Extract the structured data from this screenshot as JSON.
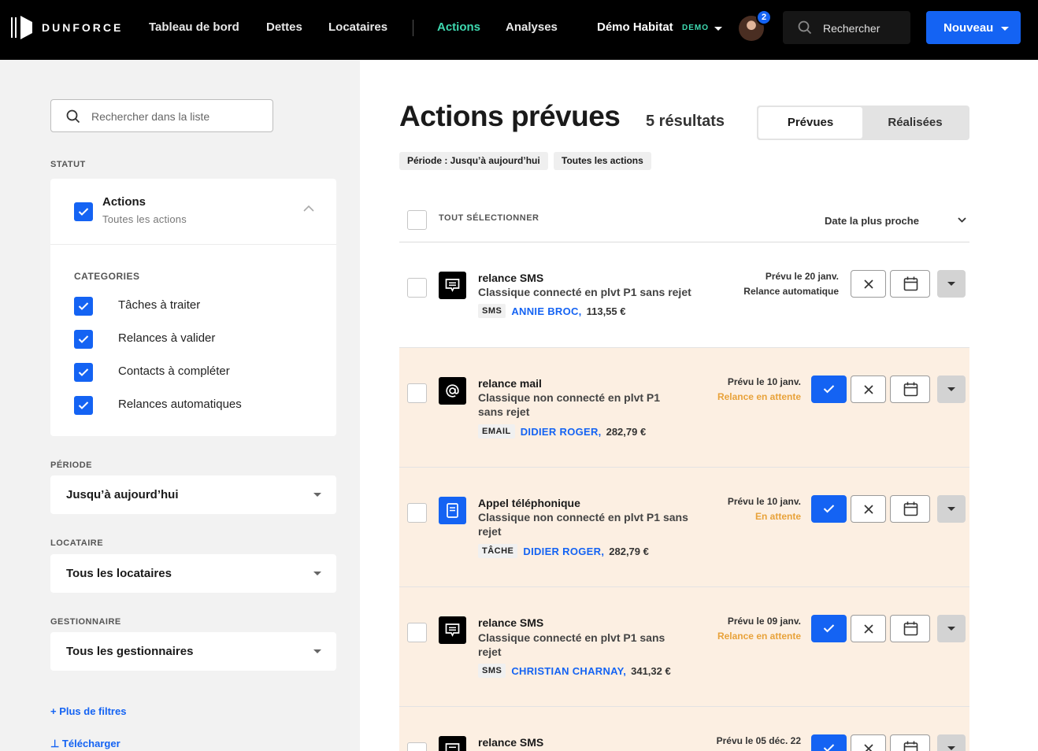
{
  "nav": {
    "brand": "DUNFORCE",
    "links": [
      "Tableau de bord",
      "Dettes",
      "Locataires",
      "Actions",
      "Analyses"
    ],
    "active": "Actions",
    "org": "Démo Habitat",
    "org_badge": "DEMO",
    "notif_count": "2",
    "search_placeholder": "Rechercher",
    "new_button": "Nouveau"
  },
  "sidebar": {
    "search_placeholder": "Rechercher dans la liste",
    "statut_label": "STATUT",
    "statut_title": "Actions",
    "statut_sub": "Toutes les actions",
    "categories_label": "CATEGORIES",
    "categories": [
      "Tâches à traiter",
      "Relances à valider",
      "Contacts à compléter",
      "Relances automatiques"
    ],
    "periode_label": "PÉRIODE",
    "periode_value": "Jusqu’à aujourd’hui",
    "locataire_label": "LOCATAIRE",
    "locataire_value": "Tous les locataires",
    "gestionnaire_label": "GESTIONNAIRE",
    "gestionnaire_value": "Tous les gestionnaires",
    "more_filters": "+ Plus de filtres",
    "download": "⊥ Télécharger"
  },
  "main": {
    "title": "Actions prévues",
    "count": "5 résultats",
    "toggle": [
      "Prévues",
      "Réalisées"
    ],
    "chips": [
      "Période : Jusqu’à aujourd’hui",
      "Toutes les actions"
    ],
    "select_all": "TOUT SÉLECTIONNER",
    "sort": "Date la plus proche",
    "rows": [
      {
        "icon": "sms-icon",
        "title": "relance SMS",
        "desc": "Classique connecté en plvt P1 sans rejet",
        "type": "SMS",
        "name": "ANNIE BROC,",
        "amount": "113,55 €",
        "date": "Prévu le 20 janv.",
        "status": "Relance automatique",
        "status_color": "#333333"
      },
      {
        "icon": "at-icon",
        "title": "relance mail",
        "desc": "Classique non connecté en plvt P1 sans rejet",
        "type": "EMAIL",
        "name": "DIDIER ROGER,",
        "amount": "282,79 €",
        "date": "Prévu le 10 janv.",
        "status": "Relance en attente",
        "status_color": "#e8a23a"
      },
      {
        "icon": "task-icon",
        "title": "Appel téléphonique",
        "desc": "Classique non connecté en plvt P1 sans rejet",
        "type": "TÂCHE",
        "name": "DIDIER ROGER,",
        "amount": "282,79 €",
        "date": "Prévu le 10 janv.",
        "status": "En attente",
        "status_color": "#e8a23a"
      },
      {
        "icon": "sms-icon",
        "title": "relance SMS",
        "desc": "Classique connecté en plvt P1 sans rejet",
        "type": "SMS",
        "name": "CHRISTIAN CHARNAY,",
        "amount": "341,32 €",
        "date": "Prévu le 09 janv.",
        "status": "Relance en attente",
        "status_color": "#e8a23a"
      },
      {
        "icon": "sms-icon",
        "title": "relance SMS",
        "desc": "",
        "type": "",
        "name": "",
        "amount": "",
        "date": "Prévu le 05 déc. 22",
        "status": "",
        "status_color": "#e8a23a"
      }
    ]
  },
  "colors": {
    "accent": "#1463f3",
    "active_nav": "#3ed9b0",
    "pending": "#e8a23a",
    "highlight_row": "#fcefe2"
  }
}
